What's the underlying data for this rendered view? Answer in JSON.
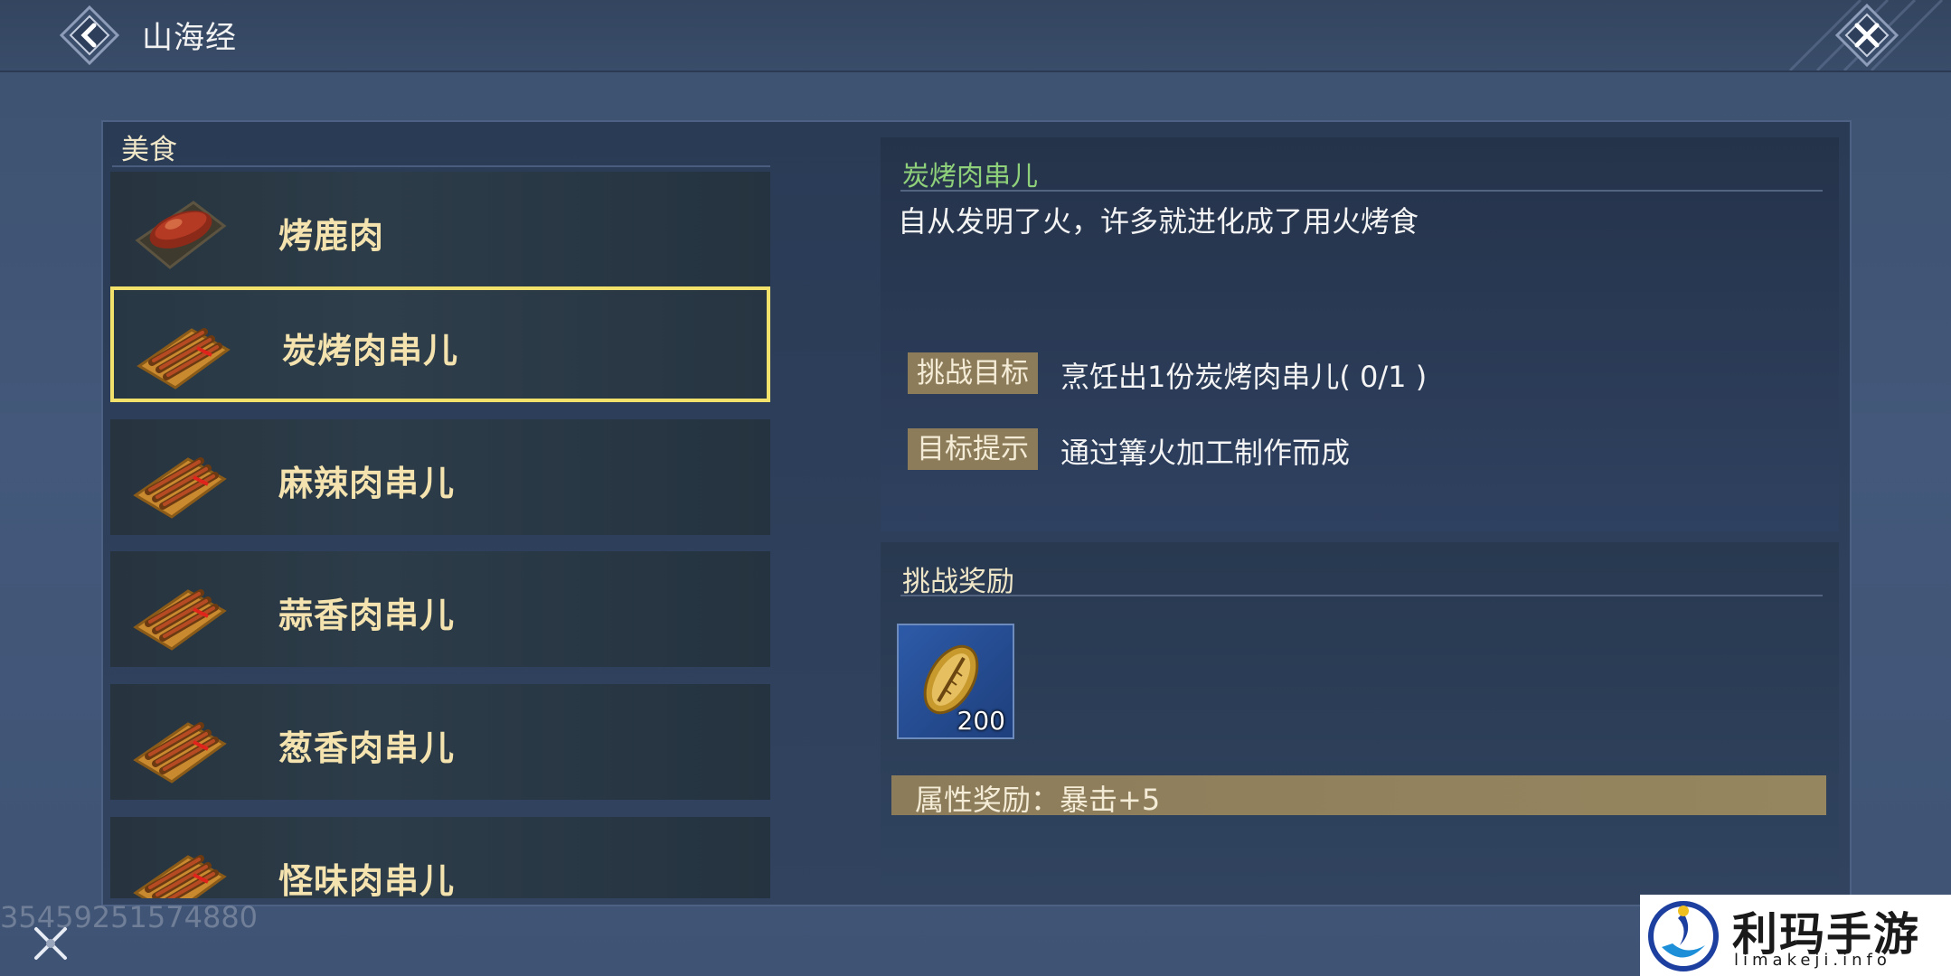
{
  "header": {
    "title": "山海经"
  },
  "food_list": {
    "header": "美食",
    "items": [
      {
        "label": "烤鹿肉",
        "icon": "roast-venison-icon"
      },
      {
        "label": "炭烤肉串儿",
        "icon": "meat-skewer-icon",
        "selected": true
      },
      {
        "label": "麻辣肉串儿",
        "icon": "meat-skewer-icon"
      },
      {
        "label": "蒜香肉串儿",
        "icon": "meat-skewer-icon"
      },
      {
        "label": "葱香肉串儿",
        "icon": "meat-skewer-icon"
      },
      {
        "label": "怪味肉串儿",
        "icon": "meat-skewer-icon"
      }
    ]
  },
  "detail": {
    "title": "炭烤肉串儿",
    "description": "自从发明了火，许多就进化成了用火烤食",
    "challenge_label": "挑战目标",
    "challenge_text": "烹饪出1份炭烤肉串儿( 0/1 )",
    "hint_label": "目标提示",
    "hint_text": "通过篝火加工制作而成"
  },
  "reward": {
    "title": "挑战奖励",
    "item_icon": "shell-coin-icon",
    "item_count": "200",
    "attribute": "属性奖励：暴击+5"
  },
  "footer": {
    "id_text": "354592515748​80"
  },
  "watermark": {
    "cn": "利玛手游",
    "en": "limakeji.info"
  },
  "colors": {
    "selected_border": "#f2e16a",
    "title_green": "#8fd17a",
    "tag_bg": "#8c7c5a"
  }
}
